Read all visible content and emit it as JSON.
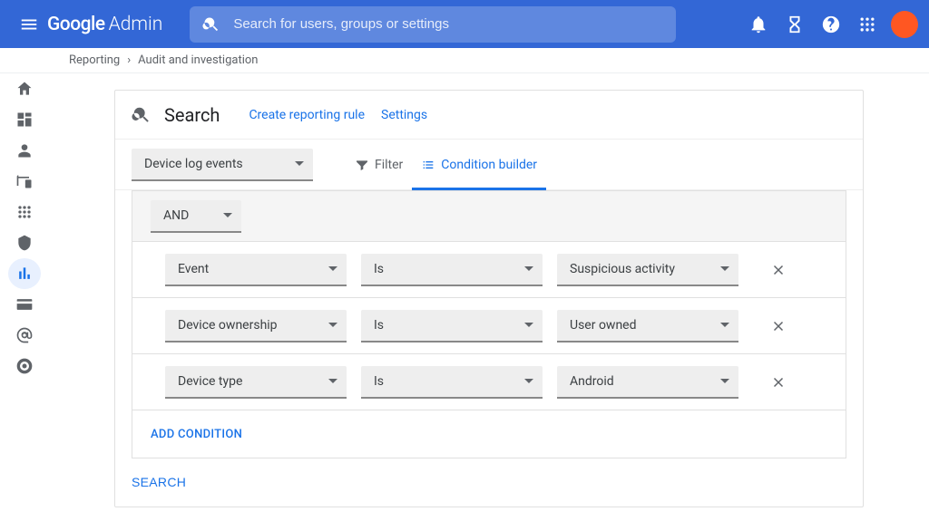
{
  "header": {
    "logo_google": "Google",
    "logo_admin": "Admin",
    "search_placeholder": "Search for users, groups or settings"
  },
  "breadcrumb": {
    "items": [
      "Reporting",
      "Audit and investigation"
    ]
  },
  "side_rail_icons": [
    "home-icon",
    "dashboard-icon",
    "person-icon",
    "devices-icon",
    "apps-icon",
    "shield-icon",
    "analytics-icon",
    "billing-icon",
    "at-icon",
    "support-icon"
  ],
  "page": {
    "title": "Search",
    "create_rule": "Create reporting rule",
    "settings": "Settings"
  },
  "tools": {
    "data_source": "Device log events",
    "tabs": {
      "filter": "Filter",
      "condition_builder": "Condition builder"
    },
    "active_tab": "condition_builder"
  },
  "conditions": {
    "join": "AND",
    "rows": [
      {
        "field": "Event",
        "operator": "Is",
        "value": "Suspicious activity"
      },
      {
        "field": "Device ownership",
        "operator": "Is",
        "value": "User owned"
      },
      {
        "field": "Device type",
        "operator": "Is",
        "value": "Android"
      }
    ],
    "add_label": "ADD CONDITION"
  },
  "actions": {
    "search": "SEARCH"
  },
  "colors": {
    "primary": "#3367d6",
    "link": "#1a73e8",
    "avatar": "#ff5722"
  }
}
